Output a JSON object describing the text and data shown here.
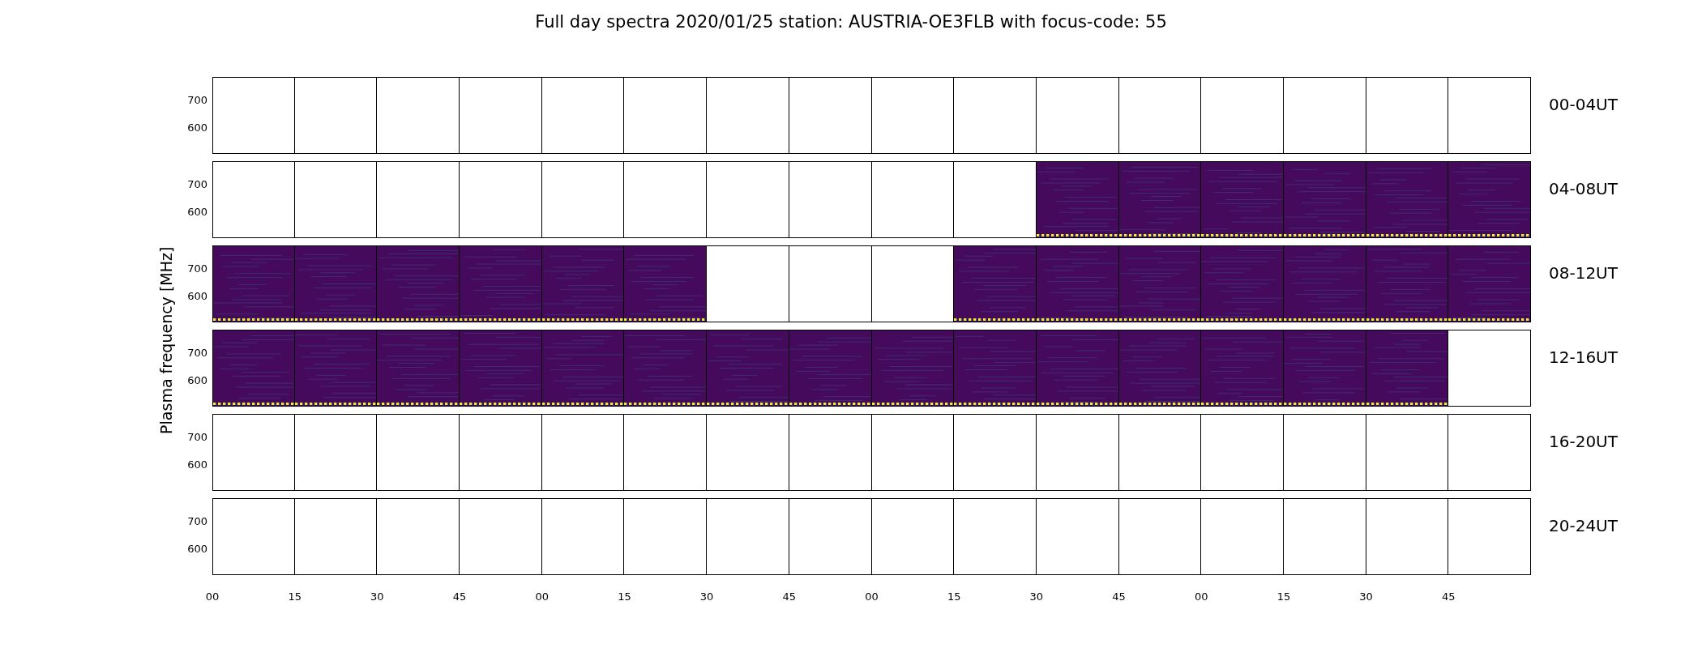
{
  "title": "Full day spectra 2020/01/25 station: AUSTRIA-OE3FLB with focus-code: 55",
  "y_axis": {
    "label": "Plasma frequency [MHz]"
  },
  "rows": [
    {
      "label": "00-04UT",
      "yticks": [
        "700",
        "600"
      ],
      "panels": [
        {
          "filled": false
        },
        {
          "filled": false
        },
        {
          "filled": false
        },
        {
          "filled": false
        },
        {
          "filled": false
        },
        {
          "filled": false
        },
        {
          "filled": false
        },
        {
          "filled": false
        },
        {
          "filled": false
        },
        {
          "filled": false
        },
        {
          "filled": false
        },
        {
          "filled": false
        },
        {
          "filled": false
        },
        {
          "filled": false
        },
        {
          "filled": false
        },
        {
          "filled": false
        }
      ]
    },
    {
      "label": "04-08UT",
      "yticks": [
        "700",
        "600"
      ],
      "panels": [
        {
          "filled": false
        },
        {
          "filled": false
        },
        {
          "filled": false
        },
        {
          "filled": false
        },
        {
          "filled": false
        },
        {
          "filled": false
        },
        {
          "filled": false
        },
        {
          "filled": false
        },
        {
          "filled": false
        },
        {
          "filled": false
        },
        {
          "filled": true
        },
        {
          "filled": true
        },
        {
          "filled": true
        },
        {
          "filled": true
        },
        {
          "filled": true
        },
        {
          "filled": true
        }
      ]
    },
    {
      "label": "08-12UT",
      "yticks": [
        "700",
        "600"
      ],
      "panels": [
        {
          "filled": true
        },
        {
          "filled": true
        },
        {
          "filled": true
        },
        {
          "filled": true
        },
        {
          "filled": true
        },
        {
          "filled": true
        },
        {
          "filled": false
        },
        {
          "filled": false
        },
        {
          "filled": false
        },
        {
          "filled": true
        },
        {
          "filled": true
        },
        {
          "filled": true
        },
        {
          "filled": true
        },
        {
          "filled": true
        },
        {
          "filled": true
        },
        {
          "filled": true
        }
      ]
    },
    {
      "label": "12-16UT",
      "yticks": [
        "700",
        "600"
      ],
      "panels": [
        {
          "filled": true
        },
        {
          "filled": true
        },
        {
          "filled": true
        },
        {
          "filled": true
        },
        {
          "filled": true
        },
        {
          "filled": true
        },
        {
          "filled": true
        },
        {
          "filled": true
        },
        {
          "filled": true
        },
        {
          "filled": true
        },
        {
          "filled": true
        },
        {
          "filled": true
        },
        {
          "filled": true
        },
        {
          "filled": true
        },
        {
          "filled": true
        },
        {
          "filled": false
        }
      ]
    },
    {
      "label": "16-20UT",
      "yticks": [
        "700",
        "600"
      ],
      "panels": [
        {
          "filled": false
        },
        {
          "filled": false
        },
        {
          "filled": false
        },
        {
          "filled": false
        },
        {
          "filled": false
        },
        {
          "filled": false
        },
        {
          "filled": false
        },
        {
          "filled": false
        },
        {
          "filled": false
        },
        {
          "filled": false
        },
        {
          "filled": false
        },
        {
          "filled": false
        },
        {
          "filled": false
        },
        {
          "filled": false
        },
        {
          "filled": false
        },
        {
          "filled": false
        }
      ]
    },
    {
      "label": "20-24UT",
      "yticks": [
        "700",
        "600"
      ],
      "panels": [
        {
          "filled": false
        },
        {
          "filled": false
        },
        {
          "filled": false
        },
        {
          "filled": false
        },
        {
          "filled": false
        },
        {
          "filled": false
        },
        {
          "filled": false
        },
        {
          "filled": false
        },
        {
          "filled": false
        },
        {
          "filled": false
        },
        {
          "filled": false
        },
        {
          "filled": false
        },
        {
          "filled": false
        },
        {
          "filled": false
        },
        {
          "filled": false
        },
        {
          "filled": false
        }
      ]
    }
  ],
  "x_ticks": [
    "00",
    "15",
    "30",
    "45",
    "00",
    "15",
    "30",
    "45",
    "00",
    "15",
    "30",
    "45",
    "00",
    "15",
    "30",
    "45"
  ]
}
